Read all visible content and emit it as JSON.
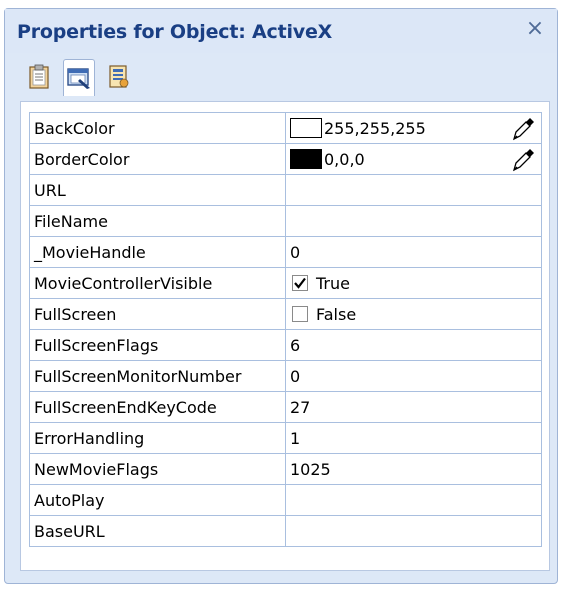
{
  "window": {
    "title": "Properties for Object: ActiveX",
    "close_glyph": "×"
  },
  "toolbar": {
    "buttons": [
      {
        "icon": "clipboard-icon",
        "active": false
      },
      {
        "icon": "object-properties-icon",
        "active": true
      },
      {
        "icon": "script-list-icon",
        "active": false
      }
    ]
  },
  "grid": {
    "rows": [
      {
        "name": "BackColor",
        "value": "255,255,255",
        "type": "color",
        "swatch": "#ffffff"
      },
      {
        "name": "BorderColor",
        "value": "0,0,0",
        "type": "color",
        "swatch": "#000000"
      },
      {
        "name": "URL",
        "value": "",
        "type": "text"
      },
      {
        "name": "FileName",
        "value": "",
        "type": "text"
      },
      {
        "name": "_MovieHandle",
        "value": "0",
        "type": "text"
      },
      {
        "name": "MovieControllerVisible",
        "value": "True",
        "type": "bool",
        "checked": true
      },
      {
        "name": "FullScreen",
        "value": "False",
        "type": "bool",
        "checked": false
      },
      {
        "name": "FullScreenFlags",
        "value": "6",
        "type": "text"
      },
      {
        "name": "FullScreenMonitorNumber",
        "value": "0",
        "type": "text"
      },
      {
        "name": "FullScreenEndKeyCode",
        "value": "27",
        "type": "text"
      },
      {
        "name": "ErrorHandling",
        "value": "1",
        "type": "text"
      },
      {
        "name": "NewMovieFlags",
        "value": "1025",
        "type": "text"
      },
      {
        "name": "AutoPlay",
        "value": "",
        "type": "text"
      },
      {
        "name": "BaseURL",
        "value": "",
        "type": "text"
      }
    ]
  },
  "colors": {
    "title_text": "#1a3f84",
    "panel_bg": "#dde8f7",
    "grid_line": "#a9bfdf"
  }
}
